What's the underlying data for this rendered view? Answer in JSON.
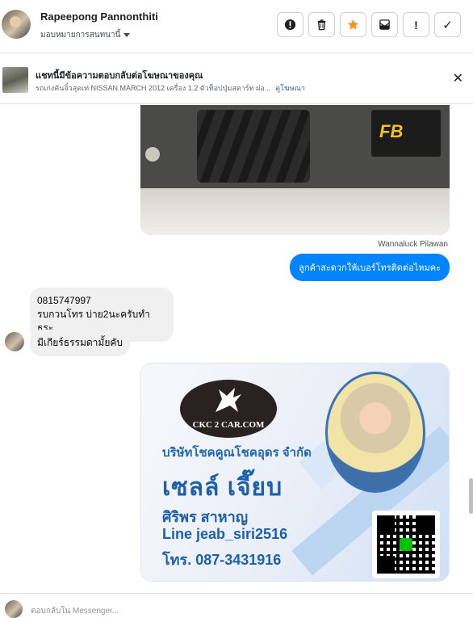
{
  "header": {
    "contact_name": "Rapeepong Pannonthiti",
    "assign_label": "มอบหมายการสนทนานี้",
    "actions": [
      {
        "icon": "exclamation-circle-icon",
        "glyph": "!"
      },
      {
        "icon": "trash-icon",
        "glyph": ""
      },
      {
        "icon": "star-icon",
        "glyph": "★"
      },
      {
        "icon": "archive-icon",
        "glyph": ""
      },
      {
        "icon": "exclamation-icon",
        "glyph": "!"
      },
      {
        "icon": "check-icon",
        "glyph": "✓"
      }
    ]
  },
  "ad_banner": {
    "title": "แชทนี้มีข้อความตอบกลับต่อโฆษณาของคุณ",
    "subtitle": "รถเก่งคันจิ๋วสุดเท่ NISSAN MARCH 2012 เครื่อง 1.2 ตัวท็อปปุ่มสตาร์ท ผ่อ...",
    "link": "ดูโฆษณา"
  },
  "messages": {
    "outgoing_sender": "Wannaluck Pilawan",
    "outgoing_text": "ลูกค้าสะดวกให้เบอร์โทรติดต่อไหมคะ",
    "incoming_1_line1": "0815747997",
    "incoming_1_line2": "รบกวนโทร บ่าย2นะครับทำ ธุระ",
    "incoming_2": "มีเกียร์ธรรมดามั้ยคับ"
  },
  "business_card": {
    "logo_text": "CKC 2 CAR.COM",
    "company": "บริษัทโชคคูณโชคอุดร จำกัด",
    "name": "เซลล์ เจี๊ยบ",
    "full_name": "ศิริพร สาหาญ",
    "line": "Line  jeab_siri2516",
    "phone": "โทร. 087-3431916"
  },
  "composer": {
    "placeholder": "ตอบกลับใน Messenger..."
  },
  "colors": {
    "brand_blue": "#0084ff",
    "star_orange": "#f7931e",
    "card_blue": "#1d5fad"
  }
}
